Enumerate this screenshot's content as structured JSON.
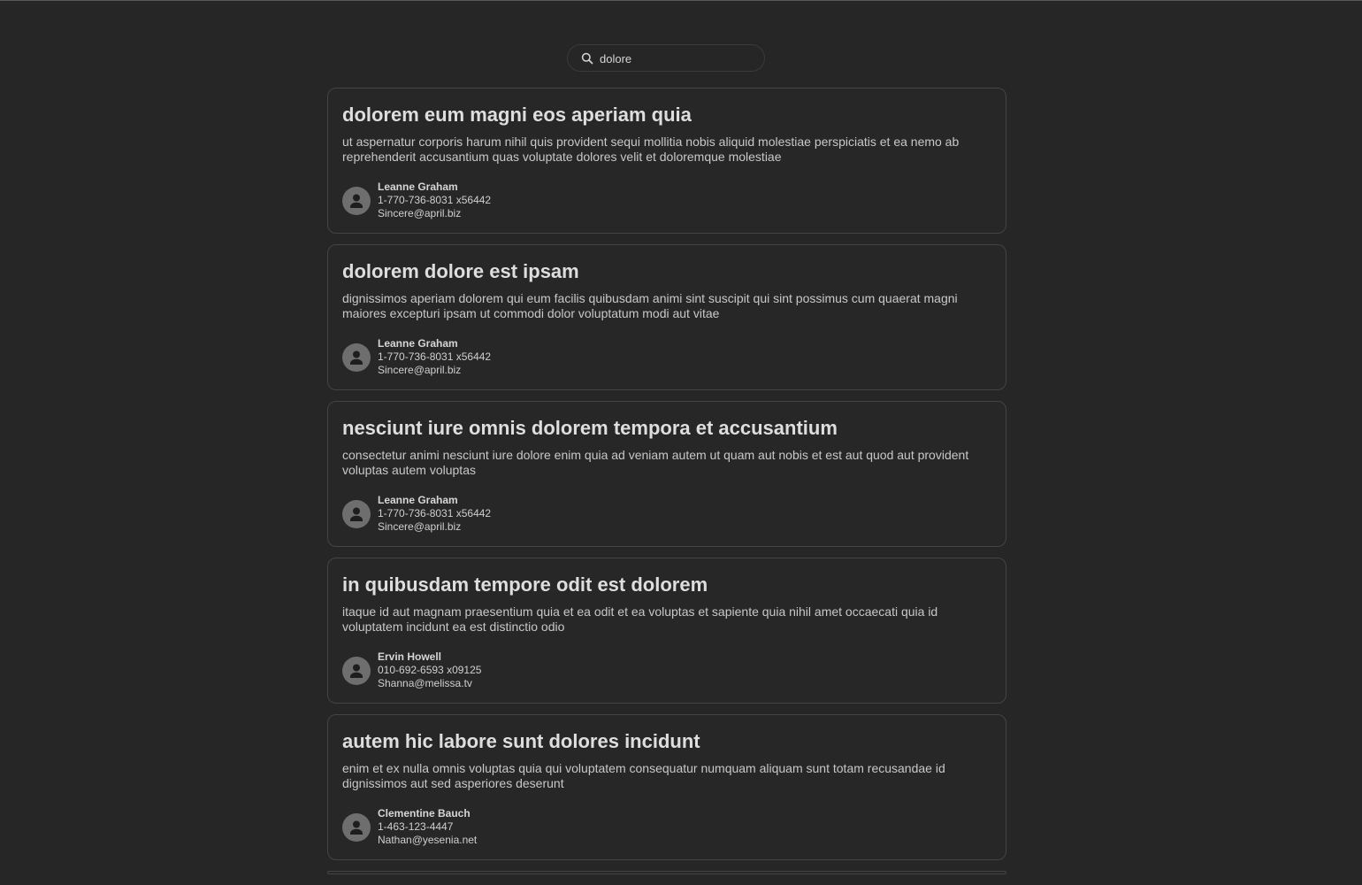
{
  "search": {
    "value": "dolore",
    "icon": "search-icon"
  },
  "posts": [
    {
      "title": "dolorem eum magni eos aperiam quia",
      "body": "ut aspernatur corporis harum nihil quis provident sequi mollitia nobis aliquid molestiae perspiciatis et ea nemo ab reprehenderit accusantium quas voluptate dolores velit et doloremque molestiae",
      "author": {
        "name": "Leanne Graham",
        "phone": "1-770-736-8031 x56442",
        "email": "Sincere@april.biz"
      }
    },
    {
      "title": "dolorem dolore est ipsam",
      "body": "dignissimos aperiam dolorem qui eum facilis quibusdam animi sint suscipit qui sint possimus cum quaerat magni maiores excepturi ipsam ut commodi dolor voluptatum modi aut vitae",
      "author": {
        "name": "Leanne Graham",
        "phone": "1-770-736-8031 x56442",
        "email": "Sincere@april.biz"
      }
    },
    {
      "title": "nesciunt iure omnis dolorem tempora et accusantium",
      "body": "consectetur animi nesciunt iure dolore enim quia ad veniam autem ut quam aut nobis et est aut quod aut provident voluptas autem voluptas",
      "author": {
        "name": "Leanne Graham",
        "phone": "1-770-736-8031 x56442",
        "email": "Sincere@april.biz"
      }
    },
    {
      "title": "in quibusdam tempore odit est dolorem",
      "body": "itaque id aut magnam praesentium quia et ea odit et ea voluptas et sapiente quia nihil amet occaecati quia id voluptatem incidunt ea est distinctio odio",
      "author": {
        "name": "Ervin Howell",
        "phone": "010-692-6593 x09125",
        "email": "Shanna@melissa.tv"
      }
    },
    {
      "title": "autem hic labore sunt dolores incidunt",
      "body": "enim et ex nulla omnis voluptas quia qui voluptatem consequatur numquam aliquam sunt totam recusandae id dignissimos aut sed asperiores deserunt",
      "author": {
        "name": "Clementine Bauch",
        "phone": "1-463-123-4447",
        "email": "Nathan@yesenia.net"
      }
    }
  ],
  "colors": {
    "background": "#262626",
    "card_border": "#444444",
    "avatar": "#6e6e6e"
  }
}
